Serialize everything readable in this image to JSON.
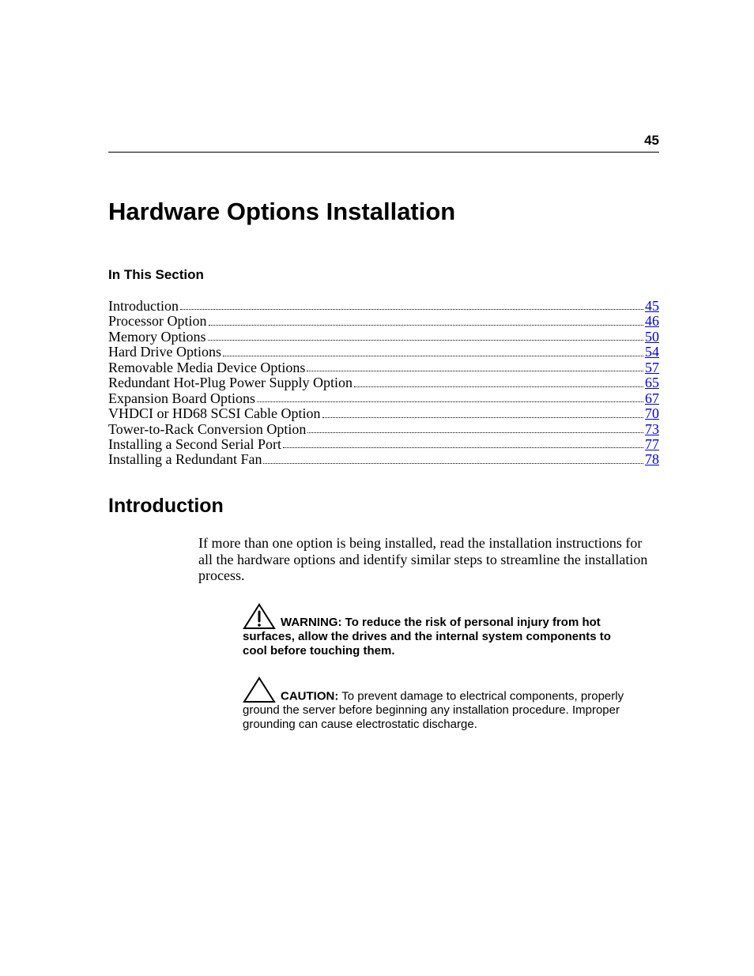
{
  "page_number": "45",
  "chapter_title": "Hardware Options Installation",
  "in_this_section_label": "In This Section",
  "toc": [
    {
      "title": "Introduction",
      "page": "45"
    },
    {
      "title": "Processor Option",
      "page": "46"
    },
    {
      "title": "Memory Options",
      "page": "50"
    },
    {
      "title": "Hard Drive Options",
      "page": "54"
    },
    {
      "title": "Removable Media Device Options",
      "page": "57"
    },
    {
      "title": "Redundant Hot-Plug Power Supply Option",
      "page": "65"
    },
    {
      "title": "Expansion Board Options",
      "page": "67"
    },
    {
      "title": "VHDCI or HD68 SCSI Cable Option",
      "page": "70"
    },
    {
      "title": "Tower-to-Rack Conversion Option",
      "page": "73"
    },
    {
      "title": "Installing a Second Serial Port",
      "page": "77"
    },
    {
      "title": "Installing a Redundant Fan",
      "page": "78"
    }
  ],
  "introduction": {
    "heading": "Introduction",
    "paragraph": "If more than one option is being installed, read the installation instructions for all the hardware options and identify similar steps to streamline the installation process."
  },
  "warning": {
    "lead": "WARNING:",
    "text": "  To reduce the risk of personal injury from hot surfaces, allow the drives and the internal system components to cool before touching them."
  },
  "caution": {
    "lead": "CAUTION:",
    "text": "  To prevent damage to electrical components, properly ground the server before beginning any installation procedure. Improper grounding can cause electrostatic discharge."
  }
}
